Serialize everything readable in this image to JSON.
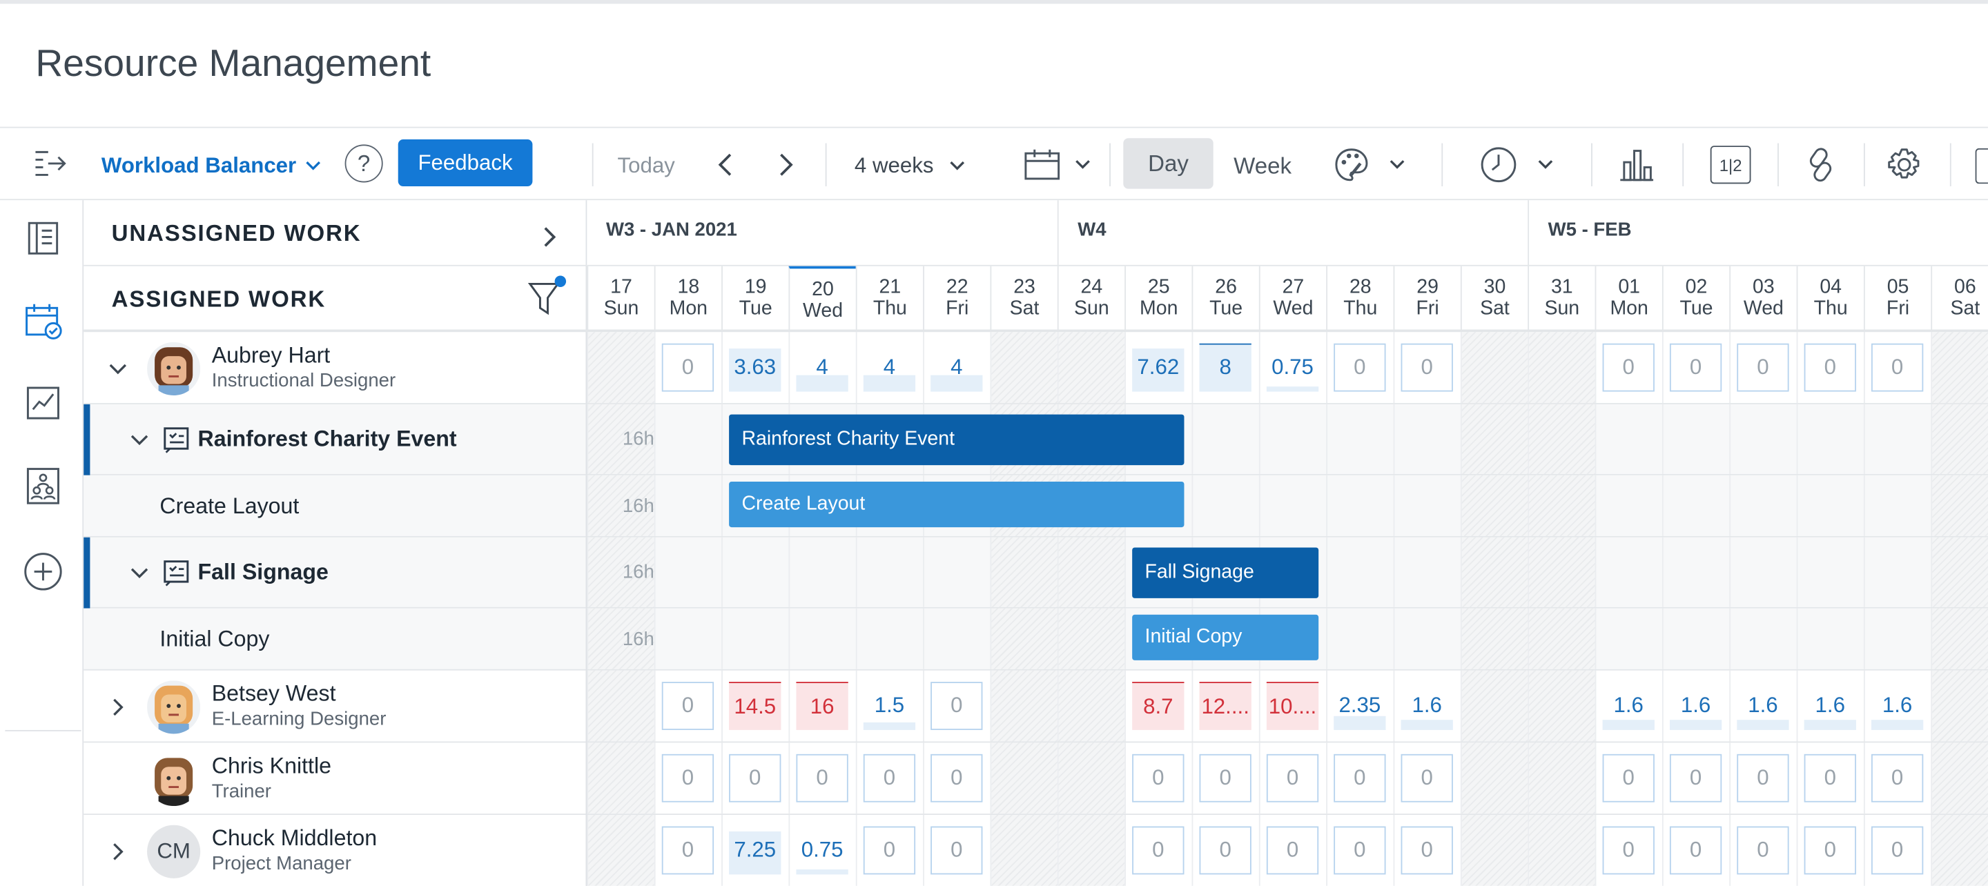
{
  "header": {
    "title": "Resource Management"
  },
  "toolbar": {
    "workload_balancer": "Workload Balancer",
    "help": "?",
    "feedback": "Feedback",
    "today": "Today",
    "range": "4 weeks",
    "day": "Day",
    "week": "Week",
    "split_label": "1|2"
  },
  "panel": {
    "unassigned": "UNASSIGNED WORK",
    "assigned": "ASSIGNED WORK"
  },
  "weeks": [
    "W3 - JAN 2021",
    "W4",
    "W5 - FEB"
  ],
  "days": [
    {
      "num": "17",
      "dow": "Sun",
      "weekend": true
    },
    {
      "num": "18",
      "dow": "Mon",
      "weekend": false
    },
    {
      "num": "19",
      "dow": "Tue",
      "weekend": false
    },
    {
      "num": "20",
      "dow": "Wed",
      "weekend": false,
      "today": true
    },
    {
      "num": "21",
      "dow": "Thu",
      "weekend": false
    },
    {
      "num": "22",
      "dow": "Fri",
      "weekend": false
    },
    {
      "num": "23",
      "dow": "Sat",
      "weekend": true
    },
    {
      "num": "24",
      "dow": "Sun",
      "weekend": true
    },
    {
      "num": "25",
      "dow": "Mon",
      "weekend": false
    },
    {
      "num": "26",
      "dow": "Tue",
      "weekend": false
    },
    {
      "num": "27",
      "dow": "Wed",
      "weekend": false
    },
    {
      "num": "28",
      "dow": "Thu",
      "weekend": false
    },
    {
      "num": "29",
      "dow": "Fri",
      "weekend": false
    },
    {
      "num": "30",
      "dow": "Sat",
      "weekend": true
    },
    {
      "num": "31",
      "dow": "Sun",
      "weekend": true
    },
    {
      "num": "01",
      "dow": "Mon",
      "weekend": false
    },
    {
      "num": "02",
      "dow": "Tue",
      "weekend": false
    },
    {
      "num": "03",
      "dow": "Wed",
      "weekend": false
    },
    {
      "num": "04",
      "dow": "Thu",
      "weekend": false
    },
    {
      "num": "05",
      "dow": "Fri",
      "weekend": false
    },
    {
      "num": "06",
      "dow": "Sat",
      "weekend": true
    }
  ],
  "people": [
    {
      "name": "Aubrey Hart",
      "role": "Instructional Designer",
      "cells": [
        "",
        "0|box",
        "3.63|val|0.9",
        "4|val|0.35",
        "4|val|0.35",
        "4|val|0.35",
        "",
        "",
        "7.62|val|0.9",
        "8|val|1.0",
        "0.75|val|0.1",
        "0|box",
        "0|box",
        "",
        "",
        "0|box",
        "0|box",
        "0|box",
        "0|box",
        "0|box",
        ""
      ]
    },
    {
      "name": "Betsey West",
      "role": "E-Learning Designer",
      "cells": [
        "",
        "0|box",
        "14.5|over",
        "16|over",
        "1.5|val|0.15",
        "0|box",
        "",
        "",
        "8.7|over",
        "12....|over",
        "10....|over",
        "2.35|val|0.3",
        "1.6|val|0.2",
        "",
        "",
        "1.6|val|0.2",
        "1.6|val|0.2",
        "1.6|val|0.2",
        "1.6|val|0.2",
        "1.6|val|0.2",
        ""
      ]
    },
    {
      "name": "Chris Knittle",
      "role": "Trainer",
      "cells": [
        "",
        "0|box",
        "0|box",
        "0|box",
        "0|box",
        "0|box",
        "",
        "",
        "0|box",
        "0|box",
        "0|box",
        "0|box",
        "0|box",
        "",
        "",
        "0|box",
        "0|box",
        "0|box",
        "0|box",
        "0|box",
        ""
      ]
    },
    {
      "name": "Chuck Middleton",
      "role": "Project Manager",
      "initials": "CM",
      "cells": [
        "",
        "0|box",
        "7.25|val|0.9",
        "0.75|val|0.1",
        "0|box",
        "0|box",
        "",
        "",
        "0|box",
        "0|box",
        "0|box",
        "0|box",
        "0|box",
        "",
        "",
        "0|box",
        "0|box",
        "0|box",
        "0|box",
        "0|box",
        ""
      ]
    }
  ],
  "work": [
    {
      "name": "Rainforest Charity Event",
      "hours": "16h",
      "type": "project",
      "bar": "Rainforest Charity Event"
    },
    {
      "name": "Create Layout",
      "hours": "16h",
      "type": "task",
      "bar": "Create Layout"
    },
    {
      "name": "Fall Signage",
      "hours": "16h",
      "type": "project",
      "bar": "Fall Signage"
    },
    {
      "name": "Initial Copy",
      "hours": "16h",
      "type": "task",
      "bar": "Initial Copy"
    }
  ],
  "colors": {
    "accent": "#1479d6",
    "project_bar": "#0b5fa8",
    "task_bar": "#3a97db",
    "over": "#d2303a"
  }
}
